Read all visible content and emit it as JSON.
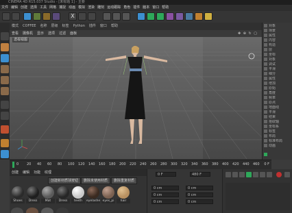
{
  "window": {
    "title": "CINEMA 4D R15.037 Studio - [未标题 1] - 主要"
  },
  "menu": {
    "items": [
      "文件",
      "编辑",
      "创建",
      "选择",
      "工具",
      "网格",
      "捕捉",
      "动画",
      "模拟",
      "渲染",
      "雕刻",
      "运动跟踪",
      "角色",
      "插件",
      "脑本",
      "窗口",
      "帮助"
    ]
  },
  "subbar": {
    "items": [
      "模式",
      "COFFEE",
      "名称",
      "层级",
      "标签",
      "Python",
      "插件",
      "窗口",
      "帮助"
    ]
  },
  "viewport": {
    "menu": [
      "查看",
      "摄像机",
      "显示",
      "选项",
      "过滤",
      "面板"
    ],
    "label": "透视视图"
  },
  "rightpanel": {
    "items": [
      "对象",
      "场景",
      "属性",
      "内容",
      "构造",
      "层",
      "坐标",
      "对象",
      "调试",
      "平滑",
      "细分",
      "属性",
      "增加",
      "原始",
      "角度",
      "频率",
      "原点",
      "地面线",
      "平滑",
      "结束",
      "拾取轴",
      "坐标系",
      "标签",
      "布局",
      "标准布局",
      "动画"
    ]
  },
  "timeline": {
    "ticks": [
      "0",
      "10",
      "20",
      "30",
      "40",
      "50",
      "60",
      "70",
      "80",
      "90",
      "100",
      "110",
      "120",
      "130",
      "140",
      "150",
      "160",
      "170",
      "180",
      "190",
      "200",
      "210",
      "220",
      "230",
      "240",
      "250",
      "260",
      "270",
      "280",
      "290",
      "300",
      "310",
      "320",
      "330",
      "340",
      "350",
      "360",
      "370",
      "380",
      "390",
      "400",
      "410",
      "420",
      "430",
      "440",
      "450",
      "460",
      "470",
      "480",
      "490"
    ],
    "end_label": "0 F"
  },
  "materials": {
    "tabs": [
      "创建",
      "编辑",
      "功能",
      "纹理"
    ],
    "buttons": [
      "创建新材质球按钮",
      "删除未使用材质",
      "删除重复材质"
    ],
    "swatches": [
      {
        "name": "Shoes",
        "color": "#2a2a2a"
      },
      {
        "name": "Dress",
        "color": "#1e1e1e"
      },
      {
        "name": "Mat",
        "color": "#5a5a5a"
      },
      {
        "name": "Dress",
        "color": "#262626"
      },
      {
        "name": "teeth",
        "color": "#dcdcdc"
      },
      {
        "name": "eyelashes",
        "color": "#3a2a20"
      },
      {
        "name": "eyes_pi",
        "color": "#7a6050"
      },
      {
        "name": "hair",
        "color": "#b89060"
      }
    ]
  },
  "coords": {
    "frame_value": "0 F",
    "end_value": "480 F",
    "fields": [
      "0 cm",
      "0 cm",
      "0 cm",
      "0 cm",
      "0 cm",
      "0 cm"
    ]
  },
  "colors": {
    "accent": "#3c8fd0",
    "green": "#2ea85a",
    "viewport_bg": "#5a5a5a"
  }
}
